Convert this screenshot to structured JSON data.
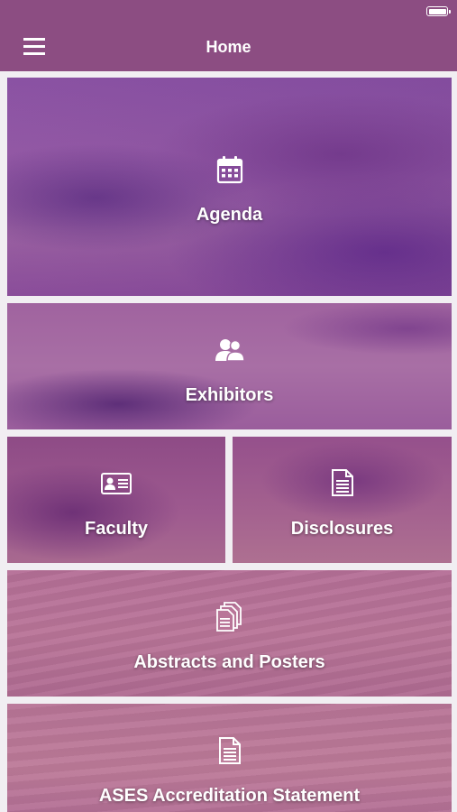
{
  "status_bar": {
    "battery_icon": "battery-full-icon"
  },
  "app_bar": {
    "menu_icon": "hamburger-menu-icon",
    "title": "Home"
  },
  "tiles": [
    {
      "label": "Agenda",
      "icon": "calendar-icon"
    },
    {
      "label": "Exhibitors",
      "icon": "people-icon"
    },
    {
      "label": "Faculty",
      "icon": "id-card-icon"
    },
    {
      "label": "Disclosures",
      "icon": "document-icon"
    },
    {
      "label": "Abstracts and Posters",
      "icon": "documents-stack-icon"
    },
    {
      "label": "ASES Accreditation Statement",
      "icon": "document-icon"
    }
  ],
  "colors": {
    "app_bar": "#8c4d82",
    "tile_overlay": "#9a5fa8",
    "text": "#ffffff"
  }
}
